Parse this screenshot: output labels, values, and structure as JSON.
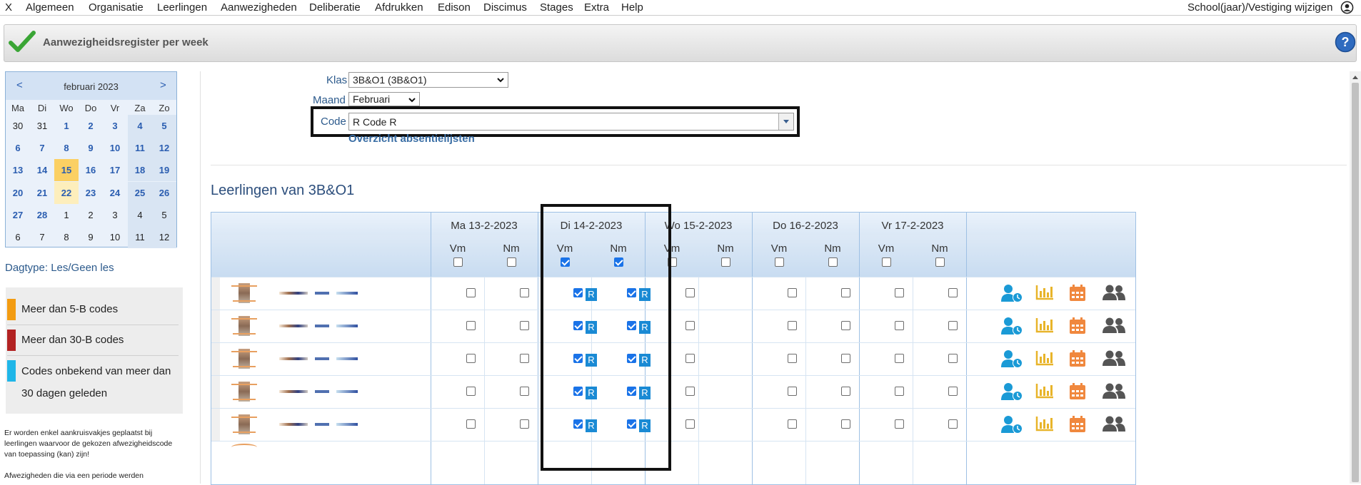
{
  "menu": {
    "close": "X",
    "items": [
      "Algemeen",
      "Organisatie",
      "Leerlingen",
      "Aanwezigheden",
      "Deliberatie",
      "Afdrukken",
      "Edison",
      "Discimus",
      "Stages",
      "Extra",
      "Help"
    ],
    "right": "School(jaar)/Vestiging wijzigen"
  },
  "title": "Aanwezigheidsregister per week",
  "calendar": {
    "prev": "<",
    "next": ">",
    "month": "februari 2023",
    "weekdays": [
      "Ma",
      "Di",
      "Wo",
      "Do",
      "Vr",
      "Za",
      "Zo"
    ],
    "rows": [
      [
        "30",
        "31",
        "1",
        "2",
        "3",
        "4",
        "5"
      ],
      [
        "6",
        "7",
        "8",
        "9",
        "10",
        "11",
        "12"
      ],
      [
        "13",
        "14",
        "15",
        "16",
        "17",
        "18",
        "19"
      ],
      [
        "20",
        "21",
        "22",
        "23",
        "24",
        "25",
        "26"
      ],
      [
        "27",
        "28",
        "1",
        "2",
        "3",
        "4",
        "5"
      ],
      [
        "6",
        "7",
        "8",
        "9",
        "10",
        "11",
        "12"
      ]
    ],
    "today": "15",
    "selected": "22"
  },
  "dagtype": "Dagtype: Les/Geen les",
  "legend": [
    {
      "color": "#f39c12",
      "label": "Meer dan 5-B codes"
    },
    {
      "color": "#b22222",
      "label": "Meer dan 30-B codes"
    },
    {
      "color": "#1fb6e8",
      "label": "Codes onbekend van meer dan 30 dagen geleden"
    }
  ],
  "note1": "Er worden enkel aankruisvakjes geplaatst bij leerlingen waarvoor de gekozen afwezigheidscode van toepassing (kan) zijn!",
  "note2": "Afwezigheden die via een periode werden",
  "form": {
    "klas_label": "Klas",
    "klas_value": "3B&O1 (3B&O1)",
    "maand_label": "Maand",
    "maand_value": "Februari",
    "code_label": "Code",
    "code_value": "R   Code R",
    "overview_link": "Overzicht absentielijsten"
  },
  "section_title": "Leerlingen van 3B&O1",
  "days": [
    {
      "label": "Ma 13-2-2023",
      "vm_all": false,
      "nm_all": false
    },
    {
      "label": "Di 14-2-2023",
      "vm_all": true,
      "nm_all": true
    },
    {
      "label": "Wo 15-2-2023",
      "vm_all": false,
      "nm_all": false
    },
    {
      "label": "Do 16-2-2023",
      "vm_all": false,
      "nm_all": false
    },
    {
      "label": "Vr 17-2-2023",
      "vm_all": false,
      "nm_all": false
    }
  ],
  "sub": {
    "vm": "Vm",
    "nm": "Nm"
  },
  "badge": "R",
  "rows_count": 5,
  "row_icons": [
    "user-clock-icon",
    "bar-chart-icon",
    "calendar-icon",
    "users-icon"
  ],
  "colors": {
    "accent": "#1a8ad4",
    "icon_blue": "#1a9ad6",
    "icon_yellow": "#e8b42a",
    "icon_orange": "#f0883e",
    "icon_gray": "#555555"
  }
}
